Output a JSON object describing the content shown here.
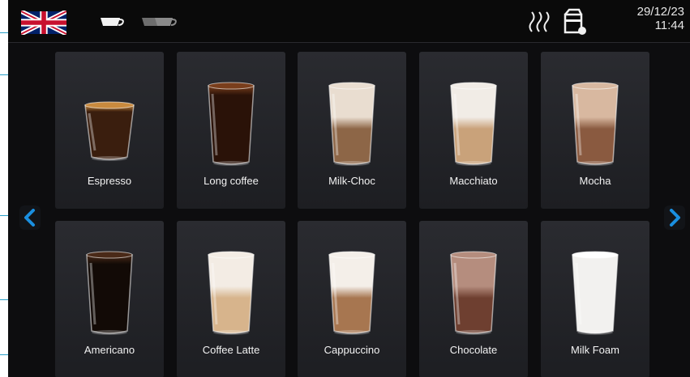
{
  "status_bar": {
    "date": "29/12/23",
    "time": "11:44",
    "flag_icon": "uk-flag-icon",
    "single_cup_icon": "single-cup-icon",
    "double_cup_icon": "double-cup-icon",
    "heating_icon": "steam-icon",
    "milk_icon": "milk-container-icon"
  },
  "beverages": [
    {
      "label": "Espresso",
      "liquid": "#3a1e0e",
      "top": "#c98a3e",
      "style": "short"
    },
    {
      "label": "Long coffee",
      "liquid": "#2a1208",
      "top": "#7a3e1c",
      "style": "dark"
    },
    {
      "label": "Milk-Choc",
      "liquid": "#8d6647",
      "top": "#e9ddd0",
      "style": "layered"
    },
    {
      "label": "Macchiato",
      "liquid": "#c9a27a",
      "top": "#f1ece6",
      "style": "layered"
    },
    {
      "label": "Mocha",
      "liquid": "#8a5a40",
      "top": "#d8b8a0",
      "style": "layered"
    },
    {
      "label": "Americano",
      "liquid": "#120a06",
      "top": "#4a2a18",
      "style": "dark"
    },
    {
      "label": "Coffee Latte",
      "liquid": "#d7b48c",
      "top": "#f3ece4",
      "style": "layered"
    },
    {
      "label": "Cappuccino",
      "liquid": "#a77650",
      "top": "#f4efe9",
      "style": "layered"
    },
    {
      "label": "Chocolate",
      "liquid": "#6e3f30",
      "top": "#b58d7e",
      "style": "layered"
    },
    {
      "label": "Milk Foam",
      "liquid": "#f2f1ef",
      "top": "#ffffff",
      "style": "white"
    }
  ],
  "colors": {
    "accent": "#1a8fe0",
    "tile": "#26272b",
    "background": "#0d0d0f"
  }
}
